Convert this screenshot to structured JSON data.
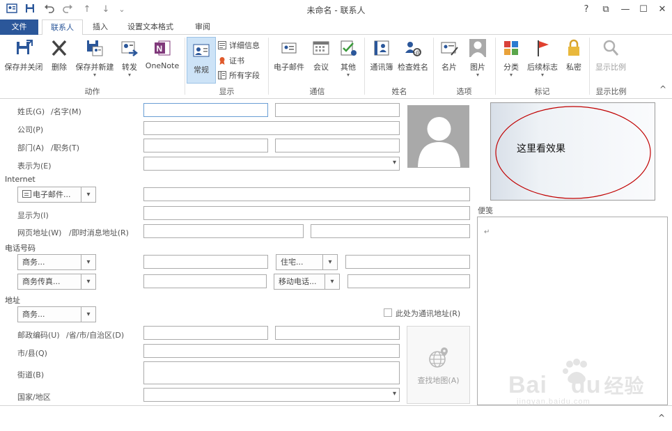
{
  "window": {
    "title": "未命名 - 联系人",
    "help": "?",
    "restore": "⧉",
    "minimize": "—",
    "maximize": "☐",
    "close": "✕"
  },
  "quick_access": {
    "up": "↑",
    "down": "↓",
    "customize": "⌄"
  },
  "tabs": [
    {
      "label": "文件"
    },
    {
      "label": "联系人"
    },
    {
      "label": "插入"
    },
    {
      "label": "设置文本格式"
    },
    {
      "label": "审阅"
    }
  ],
  "ribbon": {
    "save_close": "保存并关闭",
    "delete": "删除",
    "save_new": "保存并新建",
    "forward": "转发",
    "onenote": "OneNote",
    "general": "常规",
    "details": "详细信息",
    "certificates": "证书",
    "all_fields": "所有字段",
    "email": "电子邮件",
    "meeting": "会议",
    "more": "其他",
    "address_book": "通讯簿",
    "check_names": "检查姓名",
    "business_card": "名片",
    "picture": "图片",
    "categorize": "分类",
    "follow_up": "后续标志",
    "private": "私密",
    "zoom": "显示比例",
    "groups": {
      "actions": "动作",
      "show": "显示",
      "communicate": "通信",
      "names": "姓名",
      "options": "选项",
      "tags": "标记",
      "zoom": "显示比例"
    },
    "collapse": "^"
  },
  "form": {
    "name_label": "姓氏(G)",
    "first_name_label": "/名字(M)",
    "company_label": "公司(P)",
    "department_label": "部门(A)",
    "job_title_label": "/职务(T)",
    "file_as_label": "表示为(E)",
    "internet_section": "Internet",
    "email_button": "电子邮件...",
    "display_as_label": "显示为(I)",
    "webpage_label": "网页地址(W)",
    "im_label": "/即时消息地址(R)",
    "phone_section": "电话号码",
    "phone1": "商务...",
    "phone2": "住宅...",
    "phone3": "商务传真...",
    "phone4": "移动电话...",
    "address_section": "地址",
    "address_type": "商务...",
    "mailing_checkbox": "此处为通讯地址(R)",
    "zip_label": "邮政编码(U)",
    "province_label": "/省/市/自治区(D)",
    "city_label": "市/县(Q)",
    "street_label": "街道(B)",
    "country_label": "国家/地区",
    "map_button": "查找地图(A)",
    "notes_label": "便笺",
    "notes_mark": "↵"
  },
  "card_overlay_text": "这里看效果",
  "watermark": {
    "brand_a": "Bai",
    "brand_b": "du",
    "brand_cn": "经验",
    "url": "jingyan.baidu.com"
  },
  "colors": {
    "accent": "#2b579a",
    "annotation": "#c00000"
  }
}
